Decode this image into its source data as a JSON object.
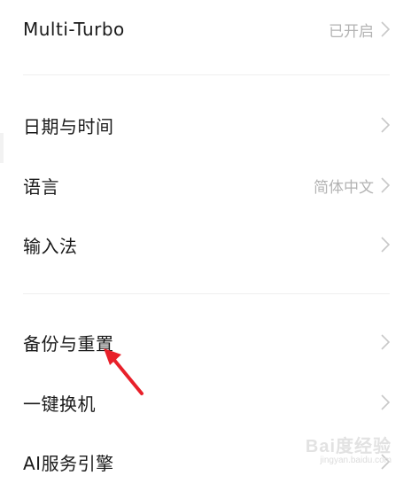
{
  "settings": {
    "items": [
      {
        "label": "Multi-Turbo",
        "value": "已开启"
      },
      {
        "label": "日期与时间",
        "value": ""
      },
      {
        "label": "语言",
        "value": "简体中文"
      },
      {
        "label": "输入法",
        "value": ""
      },
      {
        "label": "备份与重置",
        "value": ""
      },
      {
        "label": "一键换机",
        "value": ""
      },
      {
        "label": "AI服务引擎",
        "value": ""
      }
    ]
  },
  "icons": {
    "chevron": "chevron-right-icon",
    "annotation": "red-arrow"
  },
  "colors": {
    "background": "#ffffff",
    "text": "#1a1a1a",
    "secondary_text": "#b3b3b3",
    "chevron": "#c8c8c8",
    "divider": "#efefef",
    "annotation": "#e8202a"
  },
  "watermark": {
    "main": "Bai度经验",
    "sub": "jingyan.baidu.com"
  }
}
